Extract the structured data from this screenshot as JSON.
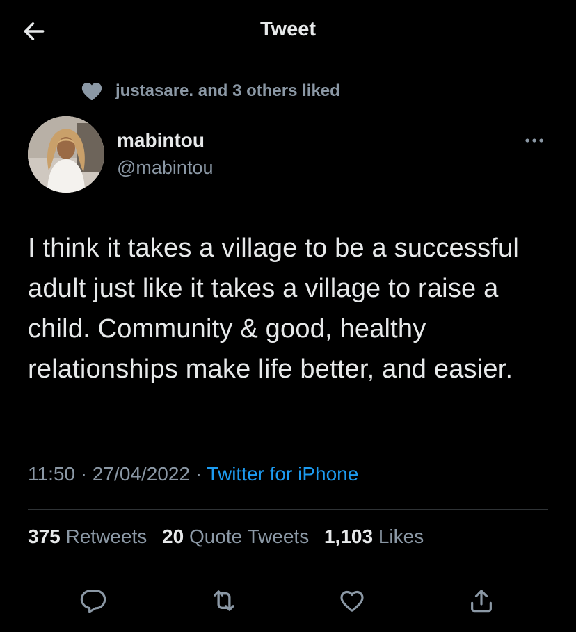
{
  "header": {
    "title": "Tweet",
    "back_icon": "arrow-left-icon"
  },
  "social_context": {
    "icon": "heart-filled-icon",
    "text": "justasare. and 3 others liked"
  },
  "author": {
    "name": "mabintou",
    "handle": "@mabintou"
  },
  "tweet": {
    "text": "I think it takes a village to be a successful adult just like it takes a village to raise a child. Community & good, healthy relationships make life better, and easier.",
    "time": "11:50",
    "separator": "·",
    "date": "27/04/2022",
    "source": "Twitter for iPhone"
  },
  "stats": {
    "retweets_count": "375",
    "retweets_label": "Retweets",
    "quotes_count": "20",
    "quotes_label": "Quote Tweets",
    "likes_count": "1,103",
    "likes_label": "Likes"
  },
  "actions": [
    "reply-icon",
    "retweet-icon",
    "like-icon",
    "share-icon"
  ],
  "colors": {
    "background": "#000000",
    "text_primary": "#e7e9ea",
    "text_secondary": "#8b98a5",
    "link": "#1d9bf0",
    "divider": "#2f3336"
  }
}
